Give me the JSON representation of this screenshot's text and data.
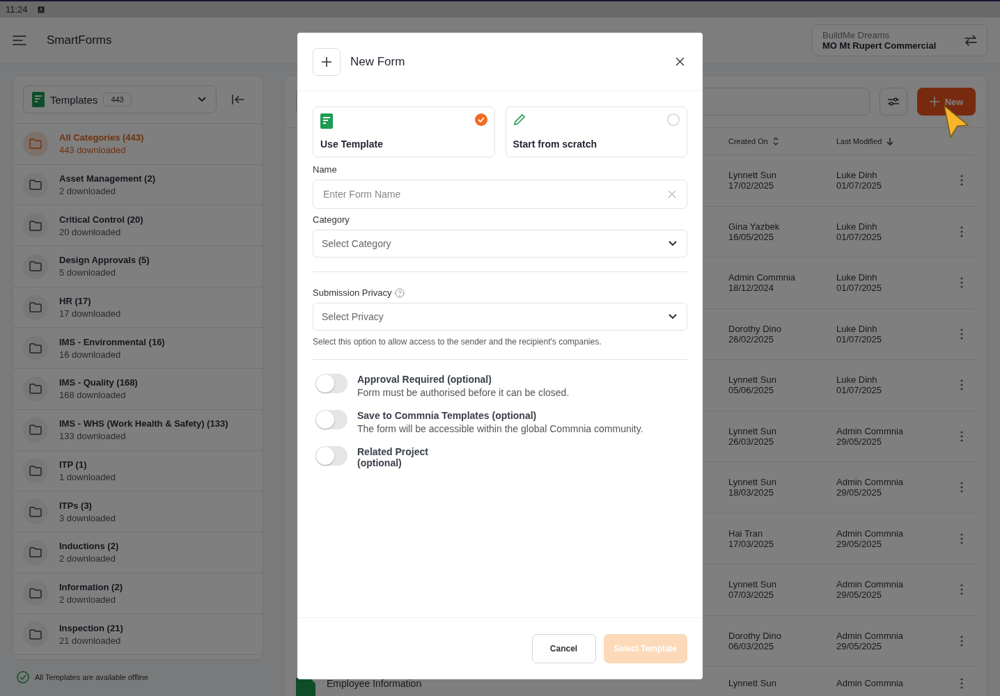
{
  "status_bar": {
    "time": "11:24"
  },
  "app_bar": {
    "title": "SmartForms",
    "company": "BuildMe Dreams",
    "project": "MO Mt Rupert Commercial"
  },
  "sidebar": {
    "selector": {
      "label": "Templates",
      "count": "443"
    },
    "items": [
      {
        "name": "All Categories (443)",
        "sub": "443 downloaded",
        "selected": true
      },
      {
        "name": "Asset Management (2)",
        "sub": "2 downloaded",
        "selected": false
      },
      {
        "name": "Critical Control (20)",
        "sub": "20 downloaded",
        "selected": false
      },
      {
        "name": "Design Approvals (5)",
        "sub": "5 downloaded",
        "selected": false
      },
      {
        "name": "HR (17)",
        "sub": "17 downloaded",
        "selected": false
      },
      {
        "name": "IMS - Environmental (16)",
        "sub": "16 downloaded",
        "selected": false
      },
      {
        "name": "IMS - Quality (168)",
        "sub": "168 downloaded",
        "selected": false
      },
      {
        "name": "IMS - WHS (Work Health & Safety) (133)",
        "sub": "133 downloaded",
        "selected": false
      },
      {
        "name": "ITP (1)",
        "sub": "1 downloaded",
        "selected": false
      },
      {
        "name": "ITPs (3)",
        "sub": "3 downloaded",
        "selected": false
      },
      {
        "name": "Inductions (2)",
        "sub": "2 downloaded",
        "selected": false
      },
      {
        "name": "Information (2)",
        "sub": "2 downloaded",
        "selected": false
      },
      {
        "name": "Inspection (21)",
        "sub": "21 downloaded",
        "selected": false
      }
    ],
    "footer": "All Templates are available offline"
  },
  "toolbar": {
    "new_button": "New"
  },
  "table": {
    "columns": [
      {
        "label": "Created On",
        "kind": "sortable"
      },
      {
        "label": "Last Modified",
        "kind": "sorted"
      }
    ],
    "rows": [
      {
        "created_by": "Lynnett Sun",
        "created_on": "17/02/2025",
        "modified_by": "Luke Dinh",
        "modified_on": "01/07/2025"
      },
      {
        "created_by": "Gina Yazbek",
        "created_on": "16/05/2025",
        "modified_by": "Luke Dinh",
        "modified_on": "01/07/2025"
      },
      {
        "created_by": "Admin Commnia",
        "created_on": "18/12/2024",
        "modified_by": "Luke Dinh",
        "modified_on": "01/07/2025"
      },
      {
        "created_by": "Dorothy Dino",
        "created_on": "26/02/2025",
        "modified_by": "Luke Dinh",
        "modified_on": "01/07/2025"
      },
      {
        "created_by": "Lynnett Sun",
        "created_on": "05/06/2025",
        "modified_by": "Luke Dinh",
        "modified_on": "01/07/2025"
      },
      {
        "created_by": "Lynnett Sun",
        "created_on": "26/03/2025",
        "modified_by": "Admin Commnia",
        "modified_on": "29/05/2025"
      },
      {
        "created_by": "Lynnett Sun",
        "created_on": "18/03/2025",
        "modified_by": "Admin Commnia",
        "modified_on": "29/05/2025"
      },
      {
        "created_by": "Hai Tran",
        "created_on": "17/03/2025",
        "modified_by": "Admin Commnia",
        "modified_on": "29/05/2025"
      },
      {
        "created_by": "Lynnett Sun",
        "created_on": "07/03/2025",
        "modified_by": "Admin Commnia",
        "modified_on": "29/05/2025"
      },
      {
        "created_by": "Dorothy Dino",
        "created_on": "06/03/2025",
        "modified_by": "Admin Commnia",
        "modified_on": "29/05/2025"
      },
      {
        "name": "Employee Information",
        "created_by": "Lynnett Sun",
        "modified_by": "Admin Commnia"
      }
    ]
  },
  "modal": {
    "title": "New Form",
    "options": [
      {
        "label": "Use Template",
        "kind": "template",
        "selected": true
      },
      {
        "label": "Start from scratch",
        "kind": "scratch",
        "selected": false
      }
    ],
    "fields": [
      {
        "label": "Name",
        "kind": "text",
        "placeholder": "Enter Form Name"
      },
      {
        "label": "Category",
        "kind": "select",
        "placeholder": "Select Category"
      }
    ],
    "privacy": {
      "label": "Submission Privacy",
      "placeholder": "Select Privacy",
      "hint": "Select this option to allow access to the sender and the recipient's companies."
    },
    "toggles": [
      {
        "title": "Approval Required (optional)",
        "description": "Form must be authorised before it can be closed.",
        "on": false
      },
      {
        "title": "Save to Commnia Templates (optional)",
        "description": "The form will be accessible within the global Commnia community.",
        "on": false
      },
      {
        "title": "Related Project (optional)",
        "on": false
      }
    ],
    "buttons": [
      {
        "label": "Cancel",
        "kind": "secondary"
      },
      {
        "label": "Select Template",
        "kind": "primary",
        "disabled": true
      }
    ]
  }
}
